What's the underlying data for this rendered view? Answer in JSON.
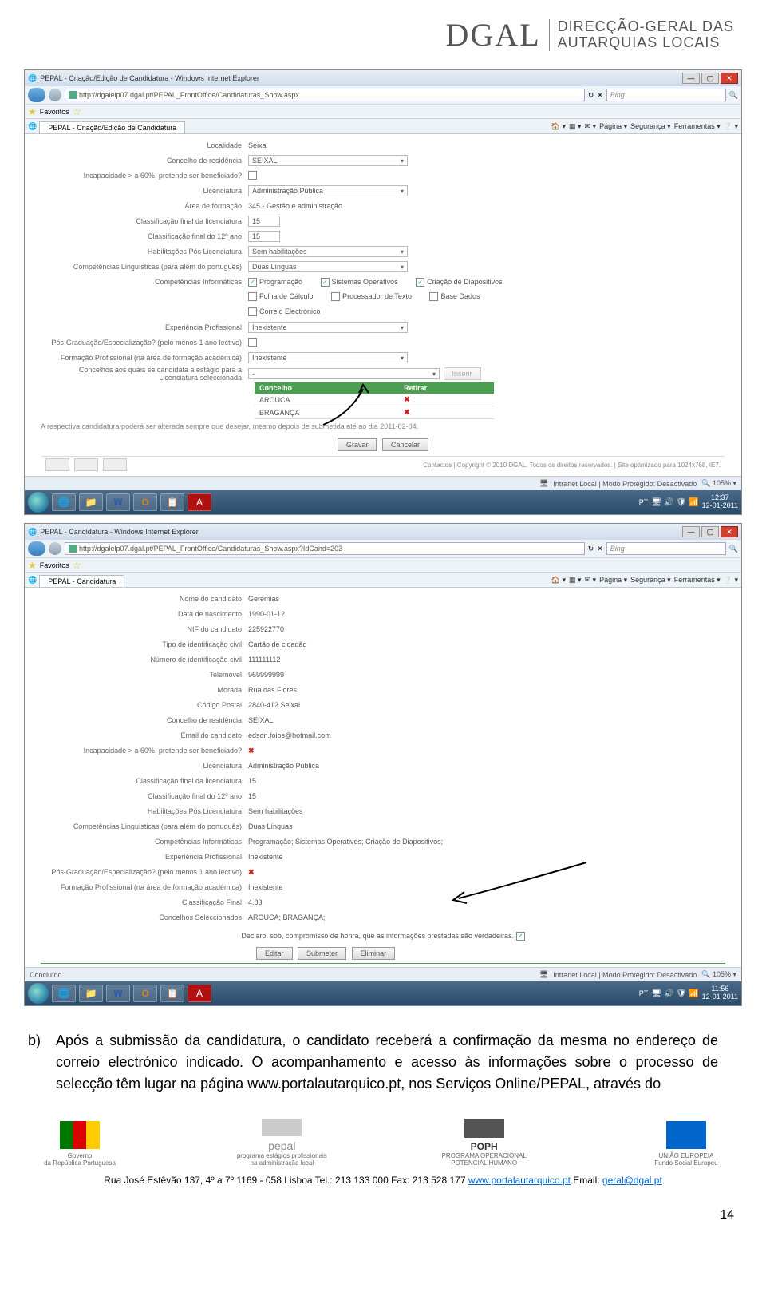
{
  "header": {
    "logo_text": "DGAL",
    "logo_sub1": "DIRECÇÃO-GERAL DAS",
    "logo_sub2": "AUTARQUIAS LOCAIS"
  },
  "screenshot1": {
    "window_title": "PEPAL - Criação/Edição de Candidatura - Windows Internet Explorer",
    "url": "http://dgalelp07.dgal.pt/PEPAL_FrontOffice/Candidaturas_Show.aspx",
    "search_placeholder": "Bing",
    "favorites": "Favoritos",
    "tab_title": "PEPAL - Criação/Edição de Candidatura",
    "toolbar": {
      "pagina": "Página",
      "seguranca": "Segurança",
      "ferramentas": "Ferramentas"
    },
    "form": {
      "localidade_label": "Localidade",
      "localidade_value": "Seixal",
      "concelho_res_label": "Concelho de residência",
      "concelho_res_value": "SEIXAL",
      "incapacidade_label": "Incapacidade > a 60%, pretende ser beneficiado?",
      "licenciatura_label": "Licenciatura",
      "licenciatura_value": "Administração Pública",
      "area_label": "Área de formação",
      "area_value": "345 - Gestão e administração",
      "class_lic_label": "Classificação final da licenciatura",
      "class_lic_value": "15",
      "class_12_label": "Classificação final do 12º ano",
      "class_12_value": "15",
      "hab_label": "Habilitações Pós Licenciatura",
      "hab_value": "Sem habilitações",
      "comp_ling_label": "Competências Linguísticas (para além do português)",
      "comp_ling_value": "Duas Línguas",
      "comp_inf_label": "Competências Informáticas",
      "checkboxes": {
        "programacao": "Programação",
        "sistemas": "Sistemas Operativos",
        "diapositivos": "Criação de Diapositivos",
        "folha": "Folha de Cálculo",
        "processador": "Processador de Texto",
        "base": "Base Dados",
        "correio": "Correio Electrónico"
      },
      "exp_label": "Experiência Profissional",
      "exp_value": "Inexistente",
      "posgrad_label": "Pós-Graduação/Especialização? (pelo menos 1 ano lectivo)",
      "formprof_label": "Formação Profissional (na área de formação académica)",
      "formprof_value": "Inexistente",
      "concelhos_label": "Concelhos aos quais se candidata a estágio para a Licenciatura seleccionada",
      "inserir": "Inserir",
      "th_concelho": "Concelho",
      "th_retirar": "Retirar",
      "row1": "AROUCA",
      "row2": "BRAGANÇA",
      "note": "A respectiva candidatura poderá ser alterada sempre que desejar, mesmo depois de submetida até ao dia 2011-02-04.",
      "gravar": "Gravar",
      "cancelar": "Cancelar",
      "copyright": "Contactos | Copyright © 2010 DGAL. Todos os direitos reservados. | Site optimizado para 1024x768, IE7."
    },
    "statusbar": {
      "intranet": "Intranet Local | Modo Protegido: Desactivado",
      "zoom": "105%"
    },
    "taskbar": {
      "lang": "PT",
      "time": "12:37",
      "date": "12-01-2011"
    }
  },
  "screenshot2": {
    "window_title": "PEPAL - Candidatura - Windows Internet Explorer",
    "url": "http://dgalelp07.dgal.pt/PEPAL_FrontOffice/Candidaturas_Show.aspx?IdCand=203",
    "search_placeholder": "Bing",
    "favorites": "Favoritos",
    "tab_title": "PEPAL - Candidatura",
    "toolbar": {
      "pagina": "Página",
      "seguranca": "Segurança",
      "ferramentas": "Ferramentas"
    },
    "form": {
      "nome_label": "Nome do candidato",
      "nome_value": "Geremias",
      "nasc_label": "Data de nascimento",
      "nasc_value": "1990-01-12",
      "nif_label": "NIF do candidato",
      "nif_value": "225922770",
      "tipo_id_label": "Tipo de identificação civil",
      "tipo_id_value": "Cartão de cidadão",
      "num_id_label": "Número de identificação civil",
      "num_id_value": "111111112",
      "tel_label": "Telemóvel",
      "tel_value": "969999999",
      "morada_label": "Morada",
      "morada_value": "Rua das Flores",
      "cp_label": "Código Postal",
      "cp_value": "2840-412 Seixal",
      "concelho_res_label": "Concelho de residência",
      "concelho_res_value": "SEIXAL",
      "email_label": "Email do candidato",
      "email_value": "edson.foios@hotmail.com",
      "incapacidade_label": "Incapacidade > a 60%, pretende ser beneficiado?",
      "licenciatura_label": "Licenciatura",
      "licenciatura_value": "Administração Pública",
      "class_lic_label": "Classificação final da licenciatura",
      "class_lic_value": "15",
      "class_12_label": "Classificação final do 12º ano",
      "class_12_value": "15",
      "hab_label": "Habilitações Pós Licenciatura",
      "hab_value": "Sem habilitações",
      "comp_ling_label": "Competências Linguísticas (para além do português)",
      "comp_ling_value": "Duas Línguas",
      "comp_inf_label": "Competências Informáticas",
      "comp_inf_value": "Programação; Sistemas Operativos; Criação de Diapositivos;",
      "exp_label": "Experiência Profissional",
      "exp_value": "Inexistente",
      "posgrad_label": "Pós-Graduação/Especialização? (pelo menos 1 ano lectivo)",
      "formprof_label": "Formação Profissional (na área de formação académica)",
      "formprof_value": "Inexistente",
      "classfinal_label": "Classificação Final",
      "classfinal_value": "4.83",
      "consel_label": "Concelhos Seleccionados",
      "consel_value": "AROUCA; BRAGANÇA;",
      "declaro": "Declaro, sob, compromisso de honra, que as informações prestadas são verdadeiras.",
      "editar": "Editar",
      "submeter": "Submeter",
      "eliminar": "Eliminar"
    },
    "statusbar": {
      "concluido": "Concluído",
      "intranet": "Intranet Local | Modo Protegido: Desactivado",
      "zoom": "105%"
    },
    "taskbar": {
      "lang": "PT",
      "time": "11:56",
      "date": "12-01-2011"
    }
  },
  "body_text": {
    "marker": "b)",
    "para": "Após a submissão da candidatura, o candidato receberá a confirmação da mesma no endereço de correio electrónico indicado. O acompanhamento e acesso às informações sobre o processo de selecção têm lugar na página www.portalautarquico.pt, nos Serviços Online/PEPAL, através do"
  },
  "footer": {
    "l1": "Governo",
    "l1b": "da República Portuguesa",
    "l2a": "pepal",
    "l2b": "programa estágios profissionais na administração local",
    "l3": "POPH",
    "l3b": "PROGRAMA OPERACIONAL POTENCIAL HUMANO",
    "l4": "UNIÃO EUROPEIA",
    "l4b": "Fundo Social Europeu",
    "address_a": "Rua José Estêvão 137, 4º a 7º 1169 - 058 Lisboa  Tel.: 213 133 000  Fax: 213 528 177  ",
    "link1": "www.portalautarquico.pt",
    "address_b": "  Email: ",
    "link2": "geral@dgal.pt",
    "page_num": "14"
  }
}
